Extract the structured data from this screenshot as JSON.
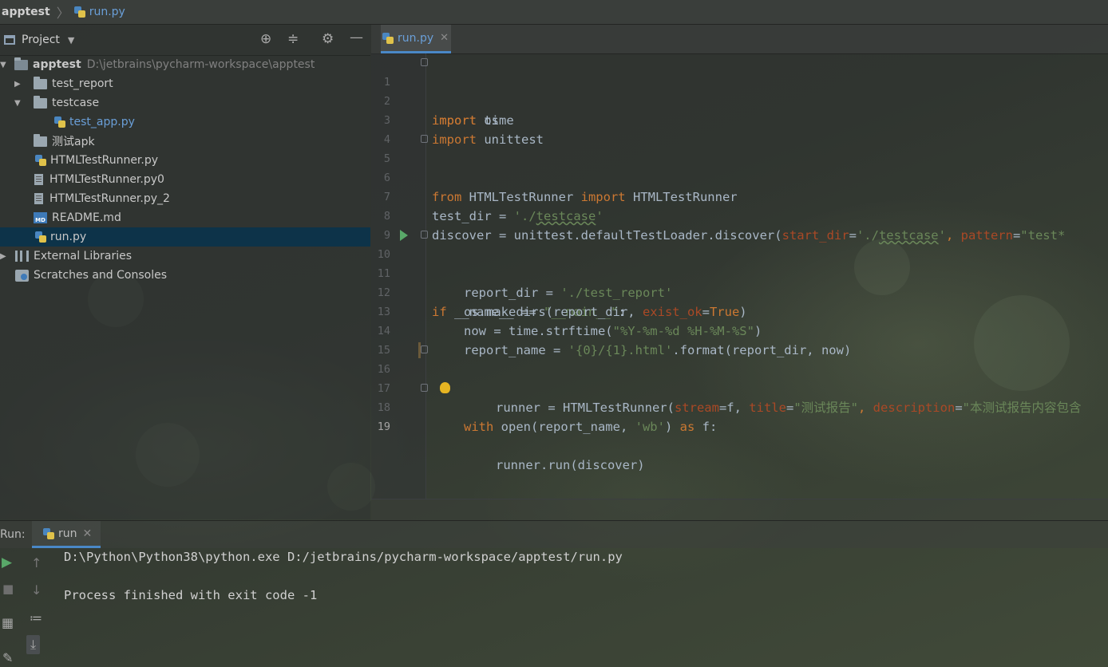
{
  "breadcrumb": {
    "project": "apptest",
    "file": "run.py"
  },
  "project_panel": {
    "title": "Project",
    "tree": [
      {
        "name": "apptest",
        "path": "D:\\jetbrains\\pycharm-workspace\\apptest"
      },
      {
        "name": "test_report"
      },
      {
        "name": "testcase"
      },
      {
        "name": "test_app.py"
      },
      {
        "name": "测试apk"
      },
      {
        "name": "HTMLTestRunner.py"
      },
      {
        "name": "HTMLTestRunner.py0"
      },
      {
        "name": "HTMLTestRunner.py_2"
      },
      {
        "name": "README.md"
      },
      {
        "name": "run.py"
      },
      {
        "name": "External Libraries"
      },
      {
        "name": "Scratches and Consoles"
      }
    ]
  },
  "editor": {
    "tab_label": "run.py",
    "line_numbers": [
      "1",
      "2",
      "3",
      "4",
      "5",
      "6",
      "7",
      "8",
      "9",
      "10",
      "11",
      "12",
      "13",
      "14",
      "15",
      "16",
      "17",
      "18",
      "19"
    ],
    "tokens": {
      "import": "import",
      "from": "from",
      "if": "if",
      "with": "with",
      "as": "as",
      "os": " os",
      "time": " time",
      "unittest": " unittest",
      "from_mod": " HTMLTestRunner ",
      "from_name": " HTMLTestRunner",
      "l7a": "test_dir = ",
      "l7b": "'./",
      "l7c": "testcase",
      "l7d": "'",
      "l8a": "discover = unittest.defaultTestLoader.discover(",
      "l8b": "start_dir",
      "l8c": "=",
      "l8d": "'./",
      "l8e": "testcase",
      "l8f": "'",
      "l8g": ", ",
      "l8h": "pattern",
      "l8i": "=",
      "l8j": "\"test*",
      "l10a": " __name__ == ",
      "l10b": "\"__main__\"",
      "l10c": ":",
      "l11a": "report_dir = ",
      "l11b": "'./test_report'",
      "l12a": "os.makedirs(report_dir, ",
      "l12b": "exist_ok",
      "l12c": "=",
      "l12d": "True",
      "l12e": ")",
      "l13a": "now = time.strftime(",
      "l13b": "\"%Y-%m-%d %H-%M-%S\"",
      "l13c": ")",
      "l14a": "report_name = ",
      "l14b": "'{0}/{1}.html'",
      "l14c": ".format(report_dir, now)",
      "l16a": " open(report_name, ",
      "l16b": "'wb'",
      "l16c": ") ",
      "l16d": " f:",
      "l17a": "runner = HTMLTestRunner(",
      "l17b": "stream",
      "l17c": "=f, ",
      "l17d": "title",
      "l17e": "=",
      "l17f": "\"测试报告\"",
      "l17g": ", ",
      "l17h": "description",
      "l17i": "=",
      "l17j": "\"本测试报告内容包含",
      "l18a": "runner.run(discover)"
    }
  },
  "run_panel": {
    "label": "Run:",
    "tab_label": "run",
    "console_lines": [
      "D:\\Python\\Python38\\python.exe D:/jetbrains/pycharm-workspace/apptest/run.py",
      "",
      "Process finished with exit code -1"
    ]
  }
}
